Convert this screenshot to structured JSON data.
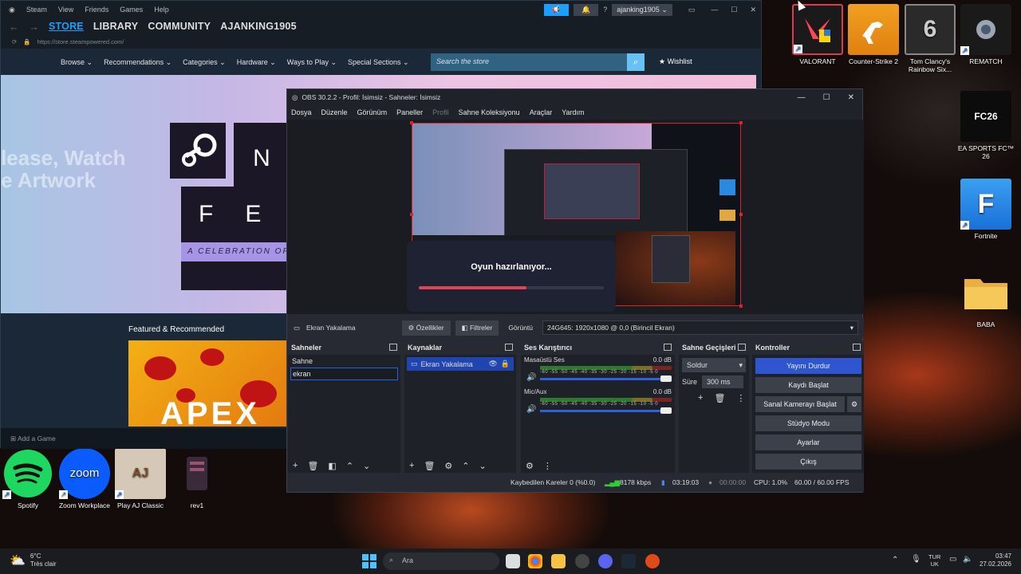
{
  "steam": {
    "menu": [
      "Steam",
      "View",
      "Friends",
      "Games",
      "Help"
    ],
    "account": "ajanking1905 ⌄",
    "tabs": [
      "STORE",
      "LIBRARY",
      "COMMUNITY",
      "AJANKING1905"
    ],
    "url": "https://store.steampowered.com/",
    "store_menu": [
      "Browse ⌄",
      "Recommendations ⌄",
      "Categories ⌄",
      "Hardware ⌄",
      "Ways to Play ⌄",
      "Special Sections ⌄"
    ],
    "search_placeholder": "Search the store",
    "wishlist": "Wishlist",
    "hero_letters": [
      "N",
      "F",
      "E"
    ],
    "hero_banner": "A CELEBRATION OF",
    "hero_left": "lease, Watch\ne Artwork",
    "featured": "Featured & Recommended",
    "apex_text": "APEX",
    "add_game": "Add a Game"
  },
  "obs": {
    "title": "OBS 30.2.2 - Profil: İsimsiz - Sahneler: İsimsiz",
    "menu": [
      "Dosya",
      "Düzenle",
      "Görünüm",
      "Paneller",
      "Profil",
      "Sahne Koleksiyonu",
      "Araçlar",
      "Yardım"
    ],
    "loading_text": "Oyun hazırlanıyor...",
    "loading_progress": 0.58,
    "source_name": "Ekran Yakalama",
    "properties": "Özellikler",
    "filters": "Filtreler",
    "display_label": "Görüntü",
    "display_value": "24G645: 1920x1080 @ 0,0 (Birincil Ekran)",
    "docks": {
      "scenes": {
        "title": "Sahneler",
        "items": [
          "Sahne",
          "ekran"
        ]
      },
      "sources": {
        "title": "Kaynaklar",
        "items": [
          "Ekran Yakalama"
        ]
      },
      "mixer": {
        "title": "Ses Karıştırıcı",
        "channels": [
          {
            "name": "Masaüstü Ses",
            "db": "0.0 dB"
          },
          {
            "name": "Mic/Aux",
            "db": "0.0 dB"
          }
        ],
        "scale": "-60 -55 -50 -45 -40 -35 -30 -25 -20 -15 -10 -5 0"
      },
      "transitions": {
        "title": "Sahne Geçişleri",
        "type": "Soldur",
        "duration_label": "Süre",
        "duration": "300 ms"
      },
      "controls": {
        "title": "Kontroller",
        "buttons": [
          "Yayını Durdur",
          "Kaydı Başlat",
          "Sanal Kamerayı Başlat",
          "Stüdyo Modu",
          "Ayarlar",
          "Çıkış"
        ]
      }
    },
    "status": {
      "dropped": "Kaybedilen Kareler 0 (%0.0)",
      "bitrate": "8178 kbps",
      "stream_time": "03:19:03",
      "rec_time": "00:00:00",
      "cpu": "CPU: 1.0%",
      "fps": "60.00 / 60.00 FPS"
    }
  },
  "desktop_icons": [
    {
      "label": "VALORANT"
    },
    {
      "label": "Counter-Strike 2"
    },
    {
      "label": "Tom Clancy's Rainbow Six..."
    },
    {
      "label": "REMATCH"
    },
    {
      "label": "EA SPORTS FC™ 26"
    },
    {
      "label": "Fortnite"
    },
    {
      "label": "BABA"
    },
    {
      "label": "Spotify"
    },
    {
      "label": "Zoom Workplace"
    },
    {
      "label": "Play AJ Classic"
    },
    {
      "label": "rev1"
    }
  ],
  "icon_texts": {
    "fc26": "FC26",
    "fortnite": "F",
    "zoom": "zoom",
    "r6": "6",
    "ajc": "AJ"
  },
  "taskbar": {
    "weather_temp": "6°C",
    "weather_desc": "Très clair",
    "search": "Ara",
    "lang_top": "TUR",
    "lang_bottom": "UK",
    "time": "03:47",
    "date": "27.02.2026"
  }
}
